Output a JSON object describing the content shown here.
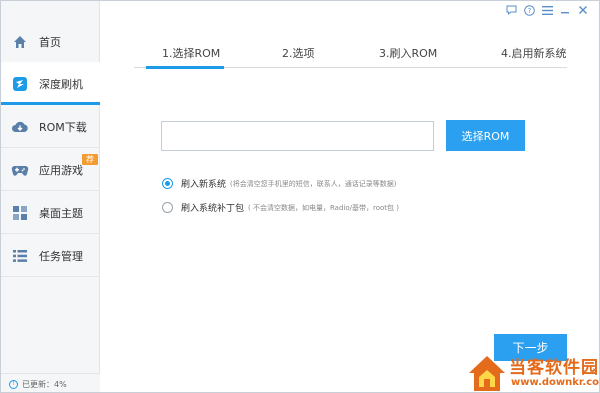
{
  "title_controls": {
    "feedback_icon": "chat-bubble-icon",
    "help_icon": "question-icon",
    "menu_icon": "menu-icon",
    "minimize_icon": "minimize-icon",
    "close_icon": "close-icon"
  },
  "sidebar": {
    "items": [
      {
        "label": "首页",
        "icon": "home-icon"
      },
      {
        "label": "深度刷机",
        "icon": "flash-icon"
      },
      {
        "label": "ROM下载",
        "icon": "cloud-download-icon"
      },
      {
        "label": "应用游戏",
        "icon": "gamepad-icon",
        "badge": "荐"
      },
      {
        "label": "桌面主题",
        "icon": "grid-icon"
      },
      {
        "label": "任务管理",
        "icon": "list-icon"
      }
    ],
    "active_index": 1,
    "status_text": "已更新：4%",
    "update_progress_percent": 4
  },
  "steps": [
    {
      "label": "1.选择ROM",
      "active": true
    },
    {
      "label": "2.选项",
      "active": false
    },
    {
      "label": "3.刷入ROM",
      "active": false
    },
    {
      "label": "4.启用新系统",
      "active": false
    }
  ],
  "rom_input": {
    "value": "",
    "placeholder": ""
  },
  "select_rom_label": "选择ROM",
  "options": [
    {
      "label": "刷入新系统",
      "note": "(将会清空您手机里的短信，联系人，通话记录等数据)",
      "checked": true
    },
    {
      "label": "刷入系统补丁包",
      "note": "( 不会清空数据，如电量，Radio/基带，root包 )",
      "checked": false
    }
  ],
  "next_label": "下一步",
  "watermark": {
    "title": "当客软件园",
    "url": "www.downkr.com"
  },
  "colors": {
    "accent": "#1e9be8",
    "button": "#2b9ff0",
    "badge": "#f39c32",
    "watermark": "#e46b1b"
  }
}
